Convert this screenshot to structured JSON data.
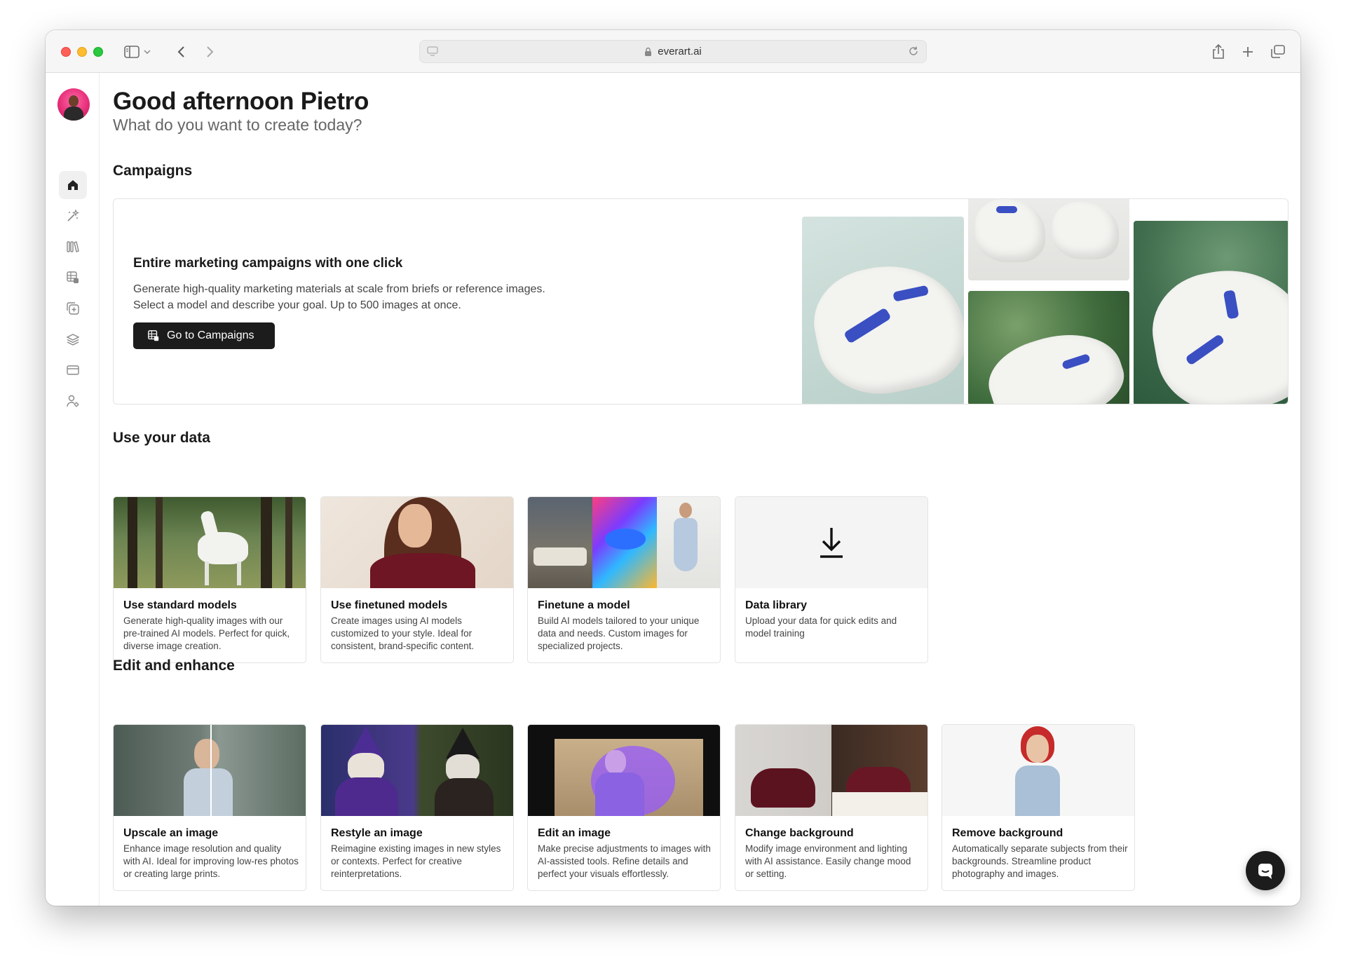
{
  "browser": {
    "url": "everart.ai"
  },
  "header": {
    "greeting": "Good afternoon Pietro",
    "subtitle": "What do you want to create today?"
  },
  "sidebar": {
    "items": [
      {
        "icon": "home-icon",
        "active": true
      },
      {
        "icon": "magic-wand-icon",
        "active": false
      },
      {
        "icon": "library-icon",
        "active": false
      },
      {
        "icon": "campaigns-icon",
        "active": false
      },
      {
        "icon": "add-image-icon",
        "active": false
      },
      {
        "icon": "layers-icon",
        "active": false
      },
      {
        "icon": "credit-card-icon",
        "active": false
      },
      {
        "icon": "user-settings-icon",
        "active": false
      }
    ]
  },
  "campaigns": {
    "section_title": "Campaigns",
    "card_title": "Entire marketing campaigns with one click",
    "card_desc": "Generate high-quality marketing materials at scale from briefs or reference images. Select a model and describe your goal. Up to 500 images at once.",
    "button_label": "Go to Campaigns"
  },
  "use_your_data": {
    "section_title": "Use your data",
    "cards": [
      {
        "title": "Use standard models",
        "desc": "Generate high-quality images with our pre-trained AI models. Perfect for quick, diverse image creation."
      },
      {
        "title": "Use finetuned models",
        "desc": "Create images using AI models customized to your style. Ideal for consistent, brand-specific content."
      },
      {
        "title": "Finetune a model",
        "desc": "Build AI models tailored to your unique data and needs. Custom images for specialized projects."
      },
      {
        "title": "Data library",
        "desc": "Upload your data for quick edits and model training"
      }
    ]
  },
  "edit_enhance": {
    "section_title": "Edit and enhance",
    "cards": [
      {
        "title": "Upscale an image",
        "desc": "Enhance image resolution and quality with AI. Ideal for improving low-res photos or creating large prints."
      },
      {
        "title": "Restyle an image",
        "desc": "Reimagine existing images in new styles or contexts. Perfect for creative reinterpretations."
      },
      {
        "title": "Edit an image",
        "desc": "Make precise adjustments to images with AI-assisted tools. Refine details and perfect your visuals effortlessly."
      },
      {
        "title": "Change background",
        "desc": "Modify image environment and lighting with AI assistance. Easily change mood or setting."
      },
      {
        "title": "Remove background",
        "desc": "Automatically separate subjects from their backgrounds. Streamline product photography and images."
      }
    ]
  },
  "support": {
    "icon": "chat-icon"
  }
}
